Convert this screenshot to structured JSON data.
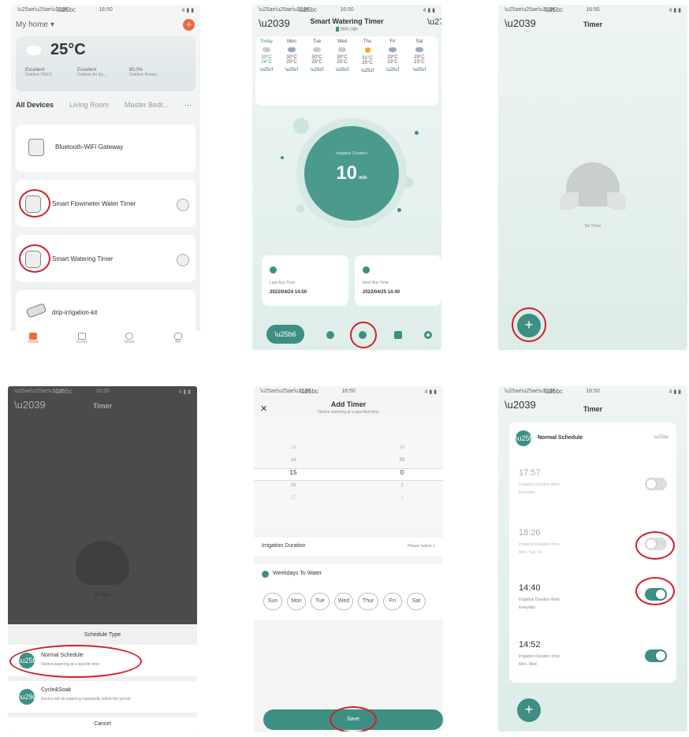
{
  "screens": {
    "home": {
      "status": {
        "time": "16:50",
        "right": "4 ▮ ▮"
      },
      "home_label": "My home ▾",
      "temperature": "25°C",
      "stats": [
        {
          "value": "Excellent",
          "label": "Outdoor PM2.5"
        },
        {
          "value": "Excellent",
          "label": "Outdoor Air Qu..."
        },
        {
          "value": "65.0%",
          "label": "Outdoor Humid..."
        }
      ],
      "tabs": [
        "All Devices",
        "Living Room",
        "Master Bedr...",
        "···"
      ],
      "devices": [
        "Bluetooth-WiFi Gateway",
        "Smart Flowmeter Water Timer",
        "Smart Watering Timer",
        "drip-irrigation-kit"
      ],
      "nav": [
        "Home",
        "Scene",
        "Smart",
        "Me"
      ]
    },
    "timer_main": {
      "status": {
        "time": "16:50",
        "right": "4 ▮ ▮"
      },
      "title": "Smart Watering Timer",
      "subtitle": "85% | Idle",
      "days": [
        {
          "name": "Today",
          "hi": "30°C",
          "lo": "24°C"
        },
        {
          "name": "Mon",
          "hi": "30°C",
          "lo": "25°C"
        },
        {
          "name": "Tue",
          "hi": "30°C",
          "lo": "25°C"
        },
        {
          "name": "Wed",
          "hi": "30°C",
          "lo": "25°C"
        },
        {
          "name": "Thu",
          "hi": "31°C",
          "lo": "25°C"
        },
        {
          "name": "Fri",
          "hi": "29°C",
          "lo": "23°C"
        },
        {
          "name": "Sat",
          "hi": "29°C",
          "lo": "23°C"
        }
      ],
      "irrigation_label": "Irrigation Duration",
      "duration": "10",
      "duration_unit": "min",
      "last_label": "Last Run Time",
      "last_value": "2022/04/24 14:50",
      "next_label": "Next Run Time",
      "next_value": "2022/04/25 14:40"
    },
    "timer_empty": {
      "status": {
        "time": "16:50",
        "right": "4 ▮ ▮"
      },
      "title": "Timer",
      "empty": "No Timer",
      "add": "+"
    },
    "schedule_type": {
      "status": {
        "time": "16:50",
        "right": "4 ▮ ▮"
      },
      "title": "Timer",
      "empty": "No Timer",
      "sheet_title": "Schedule Type",
      "options": [
        {
          "title": "Normal Schedule",
          "desc": "Device watering at a specific time"
        },
        {
          "title": "Cycle&Soak",
          "desc": "Device will do watering repeatedly within the period"
        }
      ],
      "cancel": "Cancel"
    },
    "add_timer": {
      "status": {
        "time": "16:50",
        "right": "4 ▮ ▮"
      },
      "close": "✕",
      "title": "Add Timer",
      "subtitle": "Device watering at a specified time",
      "hours": [
        "13",
        "14",
        "15",
        "16",
        "17"
      ],
      "minutes": [
        "58",
        "59",
        "0",
        "1",
        "2"
      ],
      "duration_label": "Irrigation Duration",
      "duration_value": "Please Select >",
      "weekdays_label": "Weekdays To Water",
      "weekdays": [
        "Sun",
        "Mon",
        "Tue",
        "Wed",
        "Thur",
        "Fri",
        "Sat"
      ],
      "save": "Save"
    },
    "timer_list": {
      "status": {
        "time": "16:50",
        "right": "4 ▮ ▮"
      },
      "title": "Timer",
      "group": "Normal Schedule",
      "entries": [
        {
          "time": "17:57",
          "desc": "Irrigation Duration 8min",
          "days": "Everyday",
          "on": false
        },
        {
          "time": "18:26",
          "desc": "Irrigation Duration 8min",
          "days": "Mon, Tue, Fri",
          "on": false
        },
        {
          "time": "14:40",
          "desc": "Irrigation Duration 8min",
          "days": "Everyday",
          "on": true
        },
        {
          "time": "14:52",
          "desc": "Irrigation Duration 1min",
          "days": "Mon, Wed",
          "on": true
        }
      ],
      "add": "+"
    }
  }
}
